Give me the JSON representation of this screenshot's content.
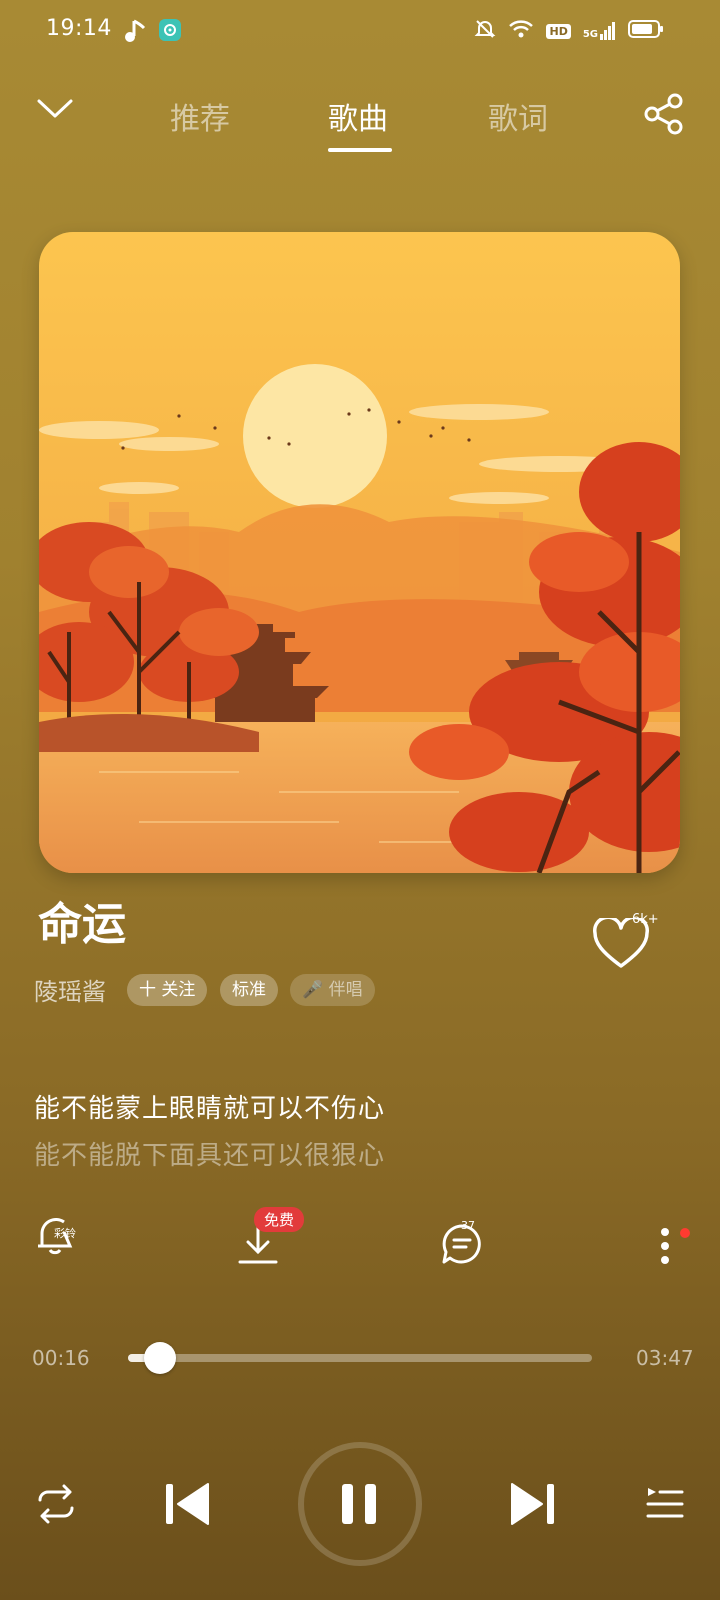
{
  "status_bar": {
    "time": "19:14",
    "hd": "HD",
    "signal": "5G"
  },
  "header": {
    "tabs": [
      {
        "label": "推荐",
        "active": false
      },
      {
        "label": "歌曲",
        "active": true
      },
      {
        "label": "歌词",
        "active": false
      }
    ]
  },
  "song": {
    "title": "命运",
    "artist": "陵瑶酱",
    "follow_label": "十 关注",
    "quality_label": "标准",
    "sing_label": "🎤 伴唱",
    "like_count": "6k+"
  },
  "lyrics": {
    "current": "能不能蒙上眼睛就可以不伤心",
    "next": "能不能脱下面具还可以很狠心"
  },
  "actions": {
    "ringtone_label": "彩铃",
    "download_badge": "免费",
    "comment_count": "37"
  },
  "progress": {
    "current": "00:16",
    "total": "03:47",
    "fraction": 0.07
  },
  "colors": {
    "background": "#a0812f",
    "badge_red": "#e23b3b",
    "dot_red": "#ff3b30"
  }
}
